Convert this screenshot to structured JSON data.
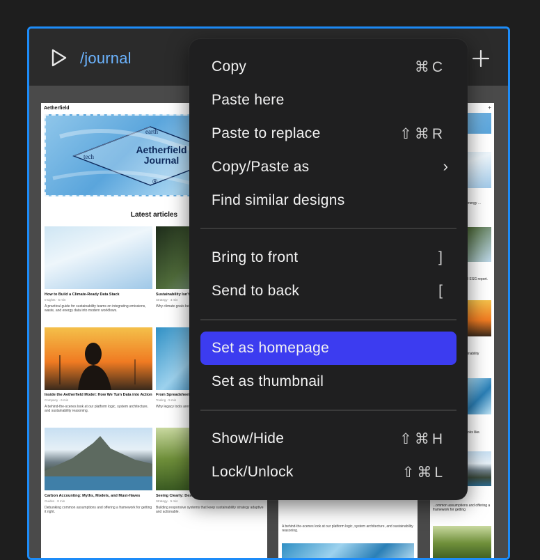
{
  "frame": {
    "route": "/journal",
    "accent": "#1d8cf8"
  },
  "page1": {
    "brand": "Aetherfield",
    "hero": {
      "title_line1": "Aetherfield",
      "title_line2": "Journal",
      "word_top": "earth",
      "word_left": "tech",
      "mark": "®"
    },
    "latest": "Latest articles",
    "cards": [
      {
        "title": "How to Build a Climate-Ready Data Stack",
        "meta": "Insights · 5 min",
        "desc": "A practical guide for sustainability teams on integrating emissions, waste, and energy data into modern workflows."
      },
      {
        "title": "Sustainability Isn't a Se...",
        "meta": "Strategy · 4 min",
        "desc": "Why climate goals belong ... ESG report."
      },
      {
        "title": "Inside the Aetherfield Model: How We Turn Data into Action",
        "meta": "Company · 6 min",
        "desc": "A behind-the-scenes look at our platform logic, system architecture, and sustainability reasoning."
      },
      {
        "title": "From Spreadsheets to ...",
        "meta": "Tooling · 5 min",
        "desc": "Why legacy tools aren't ... looks like."
      },
      {
        "title": "Carbon Accounting: Myths, Models, and Must-Haves",
        "meta": "Guides · 8 min",
        "desc": "Debunking common assumptions and offering a framework for getting it right."
      },
      {
        "title": "Seeing Clearly: Designing ...",
        "meta": "Strategy · 5 min",
        "desc": "Building responsive systems that keep sustainability strategy adaptive and actionable."
      }
    ]
  },
  "page2": {
    "footer_desc": "A behind-the-scenes look at our platform logic, system architecture, and sustainability reasoning."
  },
  "page3": {
    "latest": "...icles",
    "snippets": [
      "...ready Data Stack",
      "...eams on ...ste, and energy ...",
      "...Project: Making",
      "...to your core ...annual ESG report.",
      "...del: How We Turn",
      "...our platform ... sustainability",
      "...stems: The ...tting",
      "...ough—and what ...looks like.",
      "...Models, and",
      "...ommon assumptions and offering a framework for getting"
    ]
  },
  "menu": {
    "items": [
      {
        "label": "Copy",
        "shortcut": "⌘C"
      },
      {
        "label": "Paste here",
        "shortcut": ""
      },
      {
        "label": "Paste to replace",
        "shortcut": "⇧⌘R"
      },
      {
        "label": "Copy/Paste as",
        "shortcut": "",
        "submenu": "›"
      },
      {
        "label": "Find similar designs",
        "shortcut": ""
      },
      {
        "label": "Bring to front",
        "shortcut": "]"
      },
      {
        "label": "Send to back",
        "shortcut": "["
      },
      {
        "label": "Set as homepage",
        "shortcut": "",
        "active": true
      },
      {
        "label": "Set as thumbnail",
        "shortcut": ""
      },
      {
        "label": "Show/Hide",
        "shortcut": "⇧⌘H"
      },
      {
        "label": "Lock/Unlock",
        "shortcut": "⇧⌘L"
      }
    ],
    "active_color": "#3c3cf0"
  }
}
